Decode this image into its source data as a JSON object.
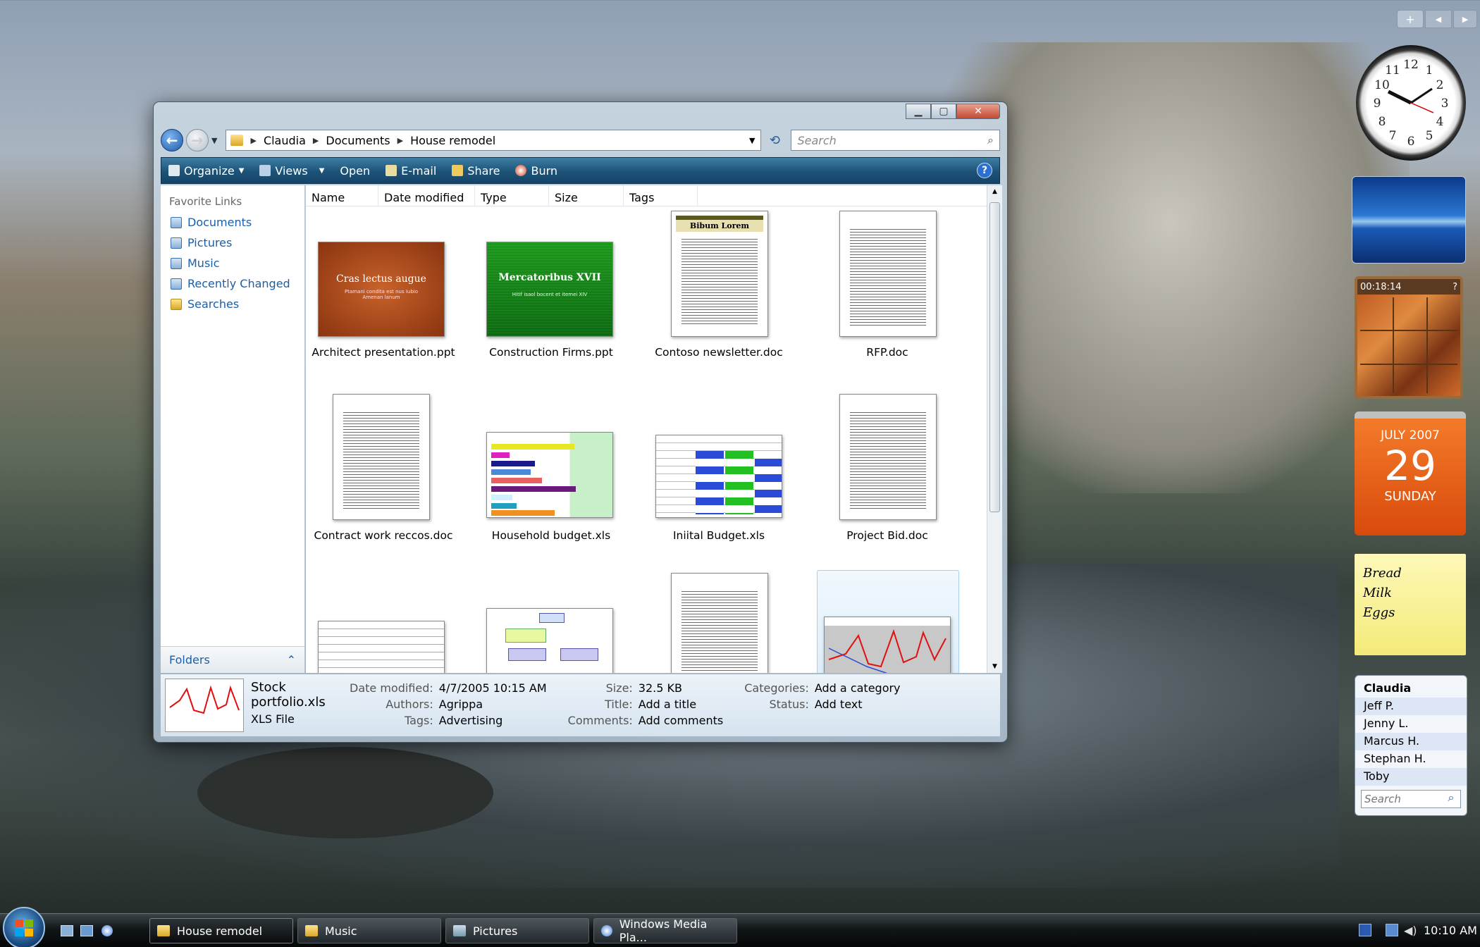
{
  "window": {
    "breadcrumb": [
      "Claudia",
      "Documents",
      "House remodel"
    ],
    "search_placeholder": "Search",
    "toolbar": {
      "organize": "Organize",
      "views": "Views",
      "open": "Open",
      "email": "E-mail",
      "share": "Share",
      "burn": "Burn"
    },
    "favorites_title": "Favorite Links",
    "favorites": [
      "Documents",
      "Pictures",
      "Music",
      "Recently Changed",
      "Searches"
    ],
    "folders_label": "Folders",
    "columns": [
      "Name",
      "Date modified",
      "Type",
      "Size",
      "Tags"
    ],
    "files": [
      {
        "name": "Architect presentation.ppt",
        "kind": "ppt",
        "slide_title": "Cras lectus augue",
        "slide_sub": "Ptamani condita est nus Iubio Amenan lanum"
      },
      {
        "name": "Construction Firms.ppt",
        "kind": "ppt",
        "slide_title": "Mercatoribus XVII",
        "slide_sub": "Hitif isaol bocent et itemei XIV"
      },
      {
        "name": "Contoso newsletter.doc",
        "kind": "newsletter",
        "heading": "Bibum Lorem"
      },
      {
        "name": "RFP.doc",
        "kind": "doc"
      },
      {
        "name": "Contract work reccos.doc",
        "kind": "doc"
      },
      {
        "name": "Household budget.xls",
        "kind": "barchart"
      },
      {
        "name": "Iniital Budget.xls",
        "kind": "spreadsheet"
      },
      {
        "name": "Project Bid.doc",
        "kind": "doc"
      }
    ],
    "details": {
      "name": "Stock portfolio.xls",
      "type": "XLS File",
      "date_label": "Date modified:",
      "date": "4/7/2005 10:15 AM",
      "authors_label": "Authors:",
      "authors": "Agrippa",
      "tags_label": "Tags:",
      "tags": "Advertising",
      "size_label": "Size:",
      "size": "32.5 KB",
      "title_label": "Title:",
      "title": "Add a title",
      "comments_label": "Comments:",
      "comments": "Add comments",
      "categories_label": "Categories:",
      "categories": "Add a category",
      "status_label": "Status:",
      "status": "Add text"
    }
  },
  "sidebar": {
    "timer": "00:18:14",
    "calendar": {
      "month": "JULY 2007",
      "day": "29",
      "weekday": "SUNDAY"
    },
    "notes": [
      "Bread",
      "Milk",
      "Eggs"
    ],
    "contacts": [
      "Claudia",
      "Jeff P.",
      "Jenny L.",
      "Marcus H.",
      "Stephan H.",
      "Toby"
    ],
    "contacts_search": "Search"
  },
  "taskbar": {
    "items": [
      "House remodel",
      "Music",
      "Pictures",
      "Windows Media Pla..."
    ],
    "clock": "10:10 AM"
  }
}
